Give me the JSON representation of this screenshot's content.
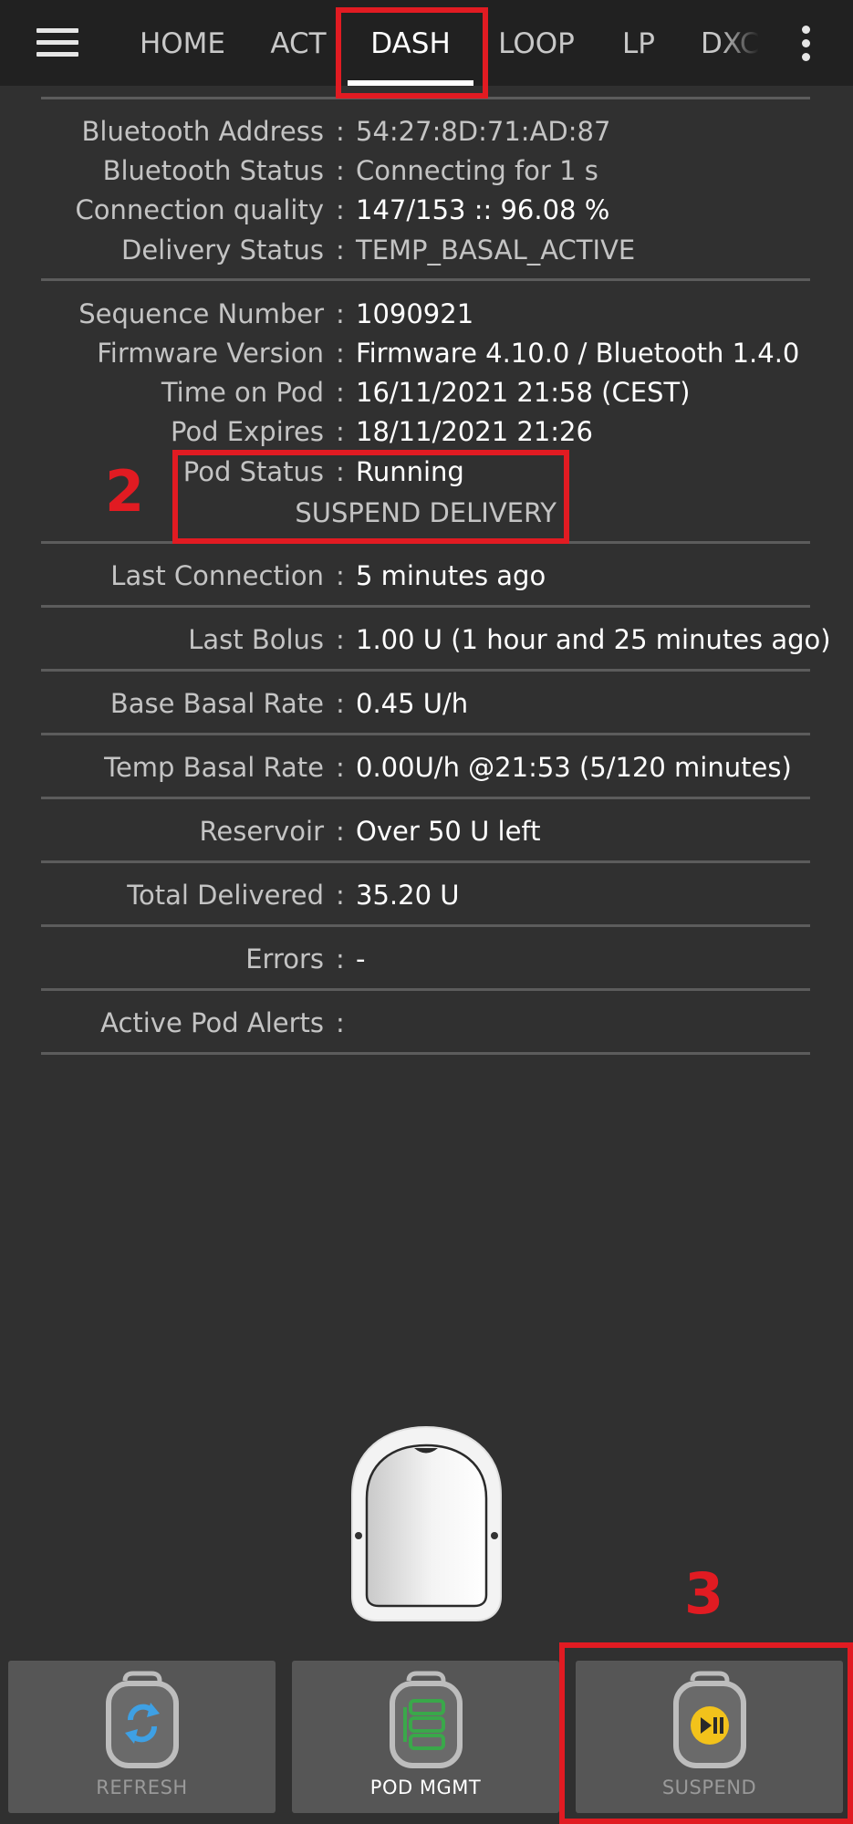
{
  "tabs": [
    "HOME",
    "ACT",
    "DASH",
    "LOOP",
    "LP",
    "DXC"
  ],
  "active_tab": "DASH",
  "rows": [
    {
      "label": "Bluetooth Address",
      "value": "54:27:8D:71:AD:87",
      "dim": true
    },
    {
      "label": "Bluetooth Status",
      "value": "Connecting for 1 s",
      "dim": true
    },
    {
      "label": "Connection quality",
      "value": "147/153 :: 96.08 %",
      "dim": false
    },
    {
      "label": "Delivery Status",
      "value": "TEMP_BASAL_ACTIVE",
      "dim": true
    },
    {
      "label": "Sequence Number",
      "value": "1090921",
      "dim": false
    },
    {
      "label": "Firmware Version",
      "value": "Firmware 4.10.0 / Bluetooth 1.4.0",
      "dim": false
    },
    {
      "label": "Time on Pod",
      "value": "16/11/2021 21:58 (CEST)",
      "dim": false
    },
    {
      "label": "Pod Expires",
      "value": "18/11/2021 21:26",
      "dim": false
    },
    {
      "label": "Pod Status",
      "value": "Running",
      "dim": false
    },
    {
      "label": "Last Connection",
      "value": "5 minutes ago",
      "dim": false
    },
    {
      "label": "Last Bolus",
      "value": "1.00 U (1 hour and 25 minutes ago)",
      "dim": false
    },
    {
      "label": "Base Basal Rate",
      "value": "0.45 U/h",
      "dim": false
    },
    {
      "label": "Temp Basal Rate",
      "value": "0.00U/h @21:53 (5/120 minutes)",
      "dim": false
    },
    {
      "label": "Reservoir",
      "value": "Over 50 U left",
      "dim": false
    },
    {
      "label": "Total Delivered",
      "value": "35.20 U",
      "dim": false
    },
    {
      "label": "Errors",
      "value": "-",
      "dim": false
    },
    {
      "label": "Active Pod Alerts",
      "value": "",
      "dim": false
    }
  ],
  "separator": ":",
  "pod_status_secondary": "SUSPEND DELIVERY",
  "buttons": {
    "refresh": "REFRESH",
    "pod_mgmt": "POD MGMT",
    "suspend": "SUSPEND"
  },
  "annotations": {
    "step_2": "2",
    "step_3": "3",
    "highlight_color": "#e11b22"
  },
  "icons": [
    "menu-icon",
    "overflow-menu-icon",
    "refresh-icon",
    "pod-management-icon",
    "play-pause-icon"
  ],
  "colors": {
    "background": "#303030",
    "topbar": "#212121",
    "button_bg": "#565656",
    "refresh_accent": "#3ea0e4",
    "podmgmt_accent": "#3aa84a",
    "suspend_accent": "#f2c21b"
  }
}
